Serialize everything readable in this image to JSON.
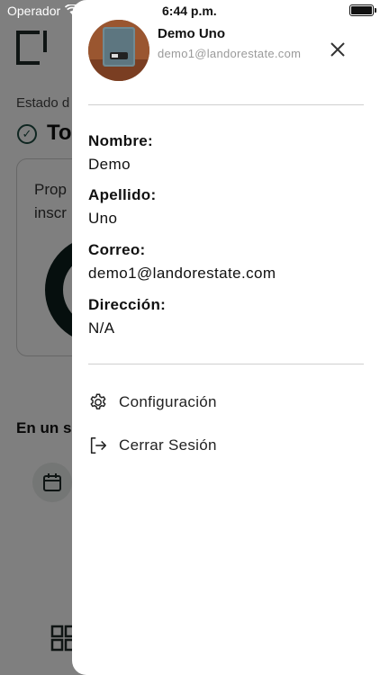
{
  "status_bar": {
    "carrier": "Operador",
    "time": "6:44 p.m."
  },
  "background": {
    "estado_label": "Estado d",
    "status_title": "To",
    "card_text_line1": "Prop",
    "card_text_line2": "inscr",
    "section_title": "En un s"
  },
  "drawer": {
    "user": {
      "name": "Demo Uno",
      "email": "demo1@landorestate.com"
    },
    "fields": [
      {
        "label": "Nombre:",
        "value": "Demo"
      },
      {
        "label": "Apellido:",
        "value": "Uno"
      },
      {
        "label": "Correo:",
        "value": "demo1@landorestate.com"
      },
      {
        "label": "Dirección:",
        "value": "N/A"
      }
    ],
    "menu": [
      {
        "label": "Configuración",
        "icon": "gear-icon"
      },
      {
        "label": "Cerrar Sesión",
        "icon": "logout-icon"
      }
    ]
  },
  "colors": {
    "overlay": "#00000080",
    "brand_dark": "#1e2b29",
    "accent_green": "#1f4d43",
    "email_gray": "#9a9a9a"
  }
}
